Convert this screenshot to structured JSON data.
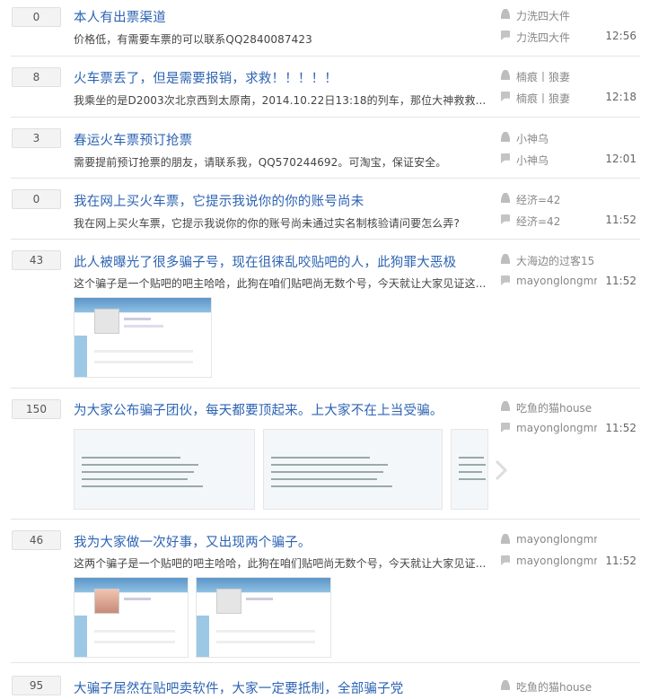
{
  "threads": [
    {
      "replies": "0",
      "title": "本人有出票渠道",
      "abstract": "价格低，有需要车票的可以联系QQ2840087423",
      "author": "力洗四大件",
      "last_replier": "力洗四大件",
      "time": "12:56"
    },
    {
      "replies": "8",
      "title": "火车票丢了，但是需要报销，求救！！！！！",
      "abstract": "我乘坐的是D2003次北京西到太原南，2014.10.22日13:18的列车，那位大神救救...",
      "author": "楠痕丨狼妻",
      "last_replier": "楠痕丨狼妻",
      "time": "12:18"
    },
    {
      "replies": "3",
      "title": "春运火车票预订抢票",
      "abstract": "需要提前预订抢票的朋友，请联系我，QQ570244692。可淘宝，保证安全。",
      "author": "小神乌",
      "last_replier": "小神乌",
      "time": "12:01"
    },
    {
      "replies": "0",
      "title": "我在网上买火车票，它提示我说你的你的账号尚未",
      "abstract": "我在网上买火车票，它提示我说你的你的账号尚未通过实名制核验请问要怎么弄?",
      "author": "经济=42",
      "last_replier": "经济=42",
      "time": "11:52"
    },
    {
      "replies": "43",
      "title": "此人被曝光了很多骗子号，现在徂徕乱咬贴吧的人，此狗罪大恶极",
      "abstract": "这个骗子是一个贴吧的吧主哈哈，此狗在咱们贴吧尚无数个号，今天就让大家见证这...",
      "author": "大海边的过客15",
      "last_replier": "mayonglongmrc",
      "time": "11:52"
    },
    {
      "replies": "150",
      "title": "为大家公布骗子团伙，每天都要顶起来。上大家不在上当受骗。",
      "abstract": "",
      "author": "吃鱼的猫house",
      "last_replier": "mayonglongmrc",
      "time": "11:52"
    },
    {
      "replies": "46",
      "title": "我为大家做一次好事，又出现两个骗子。",
      "abstract": "这两个骗子是一个贴吧的吧主哈哈，此狗在咱们贴吧尚无数个号，今天就让大家见证...",
      "author": "mayonglongmrc",
      "last_replier": "mayonglongmrc",
      "time": "11:52"
    },
    {
      "replies": "95",
      "title": "大骗子居然在贴吧卖软件，大家一定要抵制，全部骗子党",
      "abstract": "",
      "author": "吃鱼的猫house",
      "last_replier": "",
      "time": ""
    }
  ]
}
